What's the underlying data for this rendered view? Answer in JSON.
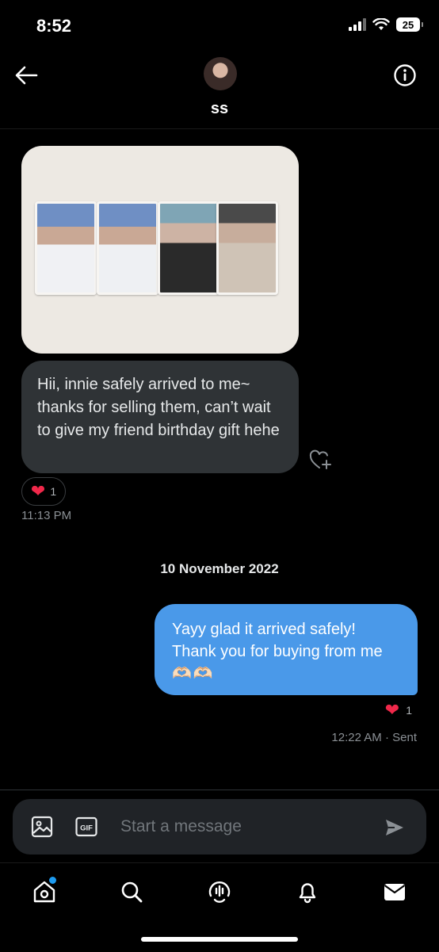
{
  "status_bar": {
    "time": "8:52",
    "battery": "25"
  },
  "header": {
    "name": "ss"
  },
  "conversation": {
    "incoming": {
      "text": "Hii, innie safely arrived to me~ thanks for selling them, can’t wait to give my friend birthday gift hehe",
      "reaction_count": "1",
      "time": "11:13 PM"
    },
    "date_divider": "10 November 2022",
    "outgoing": {
      "text": "Yayy glad it arrived safely! Thank you for buying from me",
      "emoji": "🫶🏻🫶🏻",
      "reaction_count": "1",
      "time": "12:22 AM · Sent"
    }
  },
  "composer": {
    "placeholder": "Start a message",
    "gif_label": "GIF"
  },
  "icons": {
    "back": "back-arrow-icon",
    "info": "info-icon",
    "heart_add": "heart-plus-icon",
    "media": "image-icon",
    "gif": "gif-icon",
    "send": "send-icon",
    "home": "home-icon",
    "search": "search-icon",
    "spaces": "spaces-icon",
    "notifications": "bell-icon",
    "messages": "envelope-icon"
  },
  "colors": {
    "background": "#000000",
    "incoming_bubble": "#2f3336",
    "outgoing_bubble": "#4a99e9",
    "heart": "#f0284a",
    "accent": "#1d9bf0"
  }
}
